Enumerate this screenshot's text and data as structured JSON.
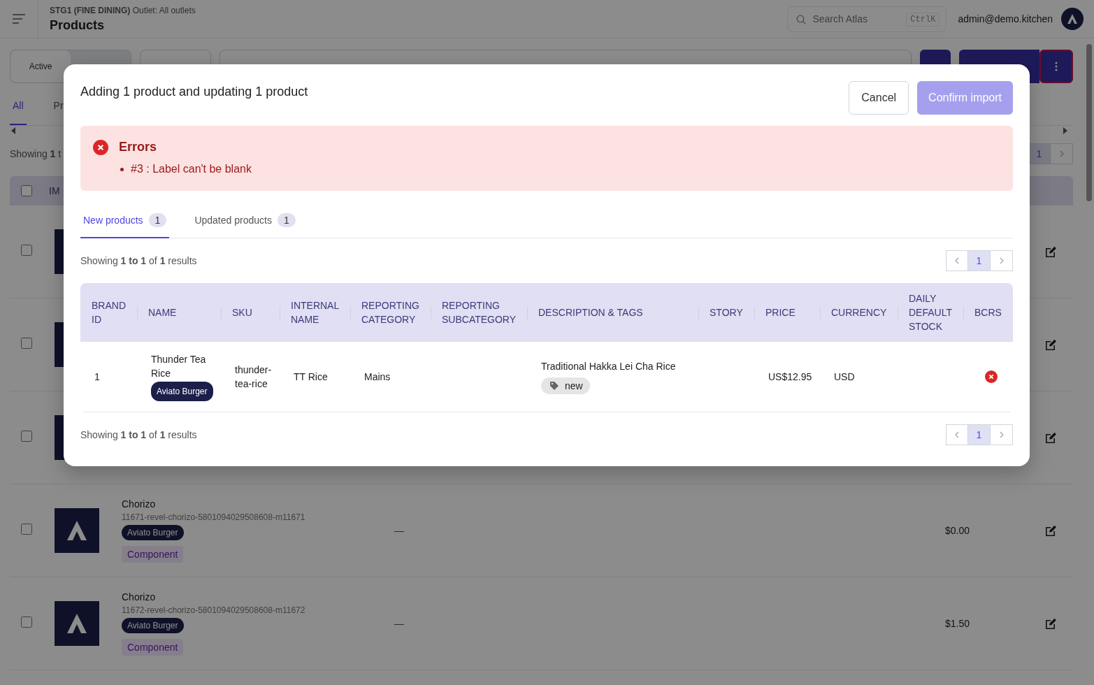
{
  "header": {
    "company": "STG1 (FINE DINING)",
    "outlet": "Outlet: All outlets",
    "title": "Products",
    "search": {
      "placeholder": "Search Atlas",
      "shortcut": "CtrlK"
    },
    "user": "admin@demo.kitchen"
  },
  "status_segments": [
    {
      "label": "Active",
      "selected": true
    },
    {
      "selected": false
    }
  ],
  "tabs": [
    {
      "label": "All",
      "selected": true
    },
    {
      "label": "Pr",
      "selected": false
    }
  ],
  "summary": "Showing **1** t",
  "pagination": {
    "page": "1"
  },
  "table": {
    "select_all_checked": false,
    "columns": [
      "IM"
    ],
    "rows": [
      {
        "checked": false
      },
      {
        "checked": false
      },
      {
        "checked": false
      },
      {
        "checked": false,
        "name": "Chorizo",
        "sku": "11671-revel-chorizo-5801094029508608-m11671",
        "brand": "Aviato Burger",
        "type": "Component",
        "column_3": "—",
        "price": "$0.00"
      },
      {
        "checked": false,
        "name": "Chorizo",
        "sku": "11672-revel-chorizo-5801094029508608-m11672",
        "brand": "Aviato Burger",
        "type": "Component",
        "column_3": "—",
        "price": "$1.50"
      }
    ]
  },
  "modal": {
    "title": "Adding 1 product and updating 1 product",
    "cancel_button": "Cancel",
    "confirm_button": {
      "label": "Confirm import",
      "disabled": true
    },
    "errors": {
      "title": "Errors",
      "items": [
        "#3 : Label can't be blank"
      ]
    },
    "tabs": [
      {
        "label": "New products",
        "count": "1",
        "selected": true
      },
      {
        "label": "Updated products",
        "count": "1",
        "selected": false
      }
    ],
    "summary_top": "Showing **1 to 1** of **1** results",
    "pagination_top": {
      "page": "1"
    },
    "table": {
      "columns": [
        "BRAND ID",
        "NAME",
        "SKU",
        "INTERNAL NAME",
        "REPORTING CATEGORY",
        "REPORTING SUBCATEGORY",
        "DESCRIPTION & TAGS",
        "STORY",
        "PRICE",
        "CURRENCY",
        "DAILY DEFAULT STOCK",
        "BCRS"
      ],
      "rows": [
        {
          "brand_id": "1",
          "name": "Thunder Tea Rice",
          "brand": "Aviato Burger",
          "sku": "thunder-tea-rice",
          "internal_name": "TT Rice",
          "reporting_category": "Mains",
          "description": "Traditional Hakka Lei Cha Rice",
          "tags": [
            "new"
          ],
          "price": "US$12.95",
          "currency": "USD",
          "bcrs_valid": false
        }
      ]
    },
    "summary_bottom": "Showing **1 to 1** of **1** results",
    "pagination_bottom": {
      "page": "1"
    }
  }
}
